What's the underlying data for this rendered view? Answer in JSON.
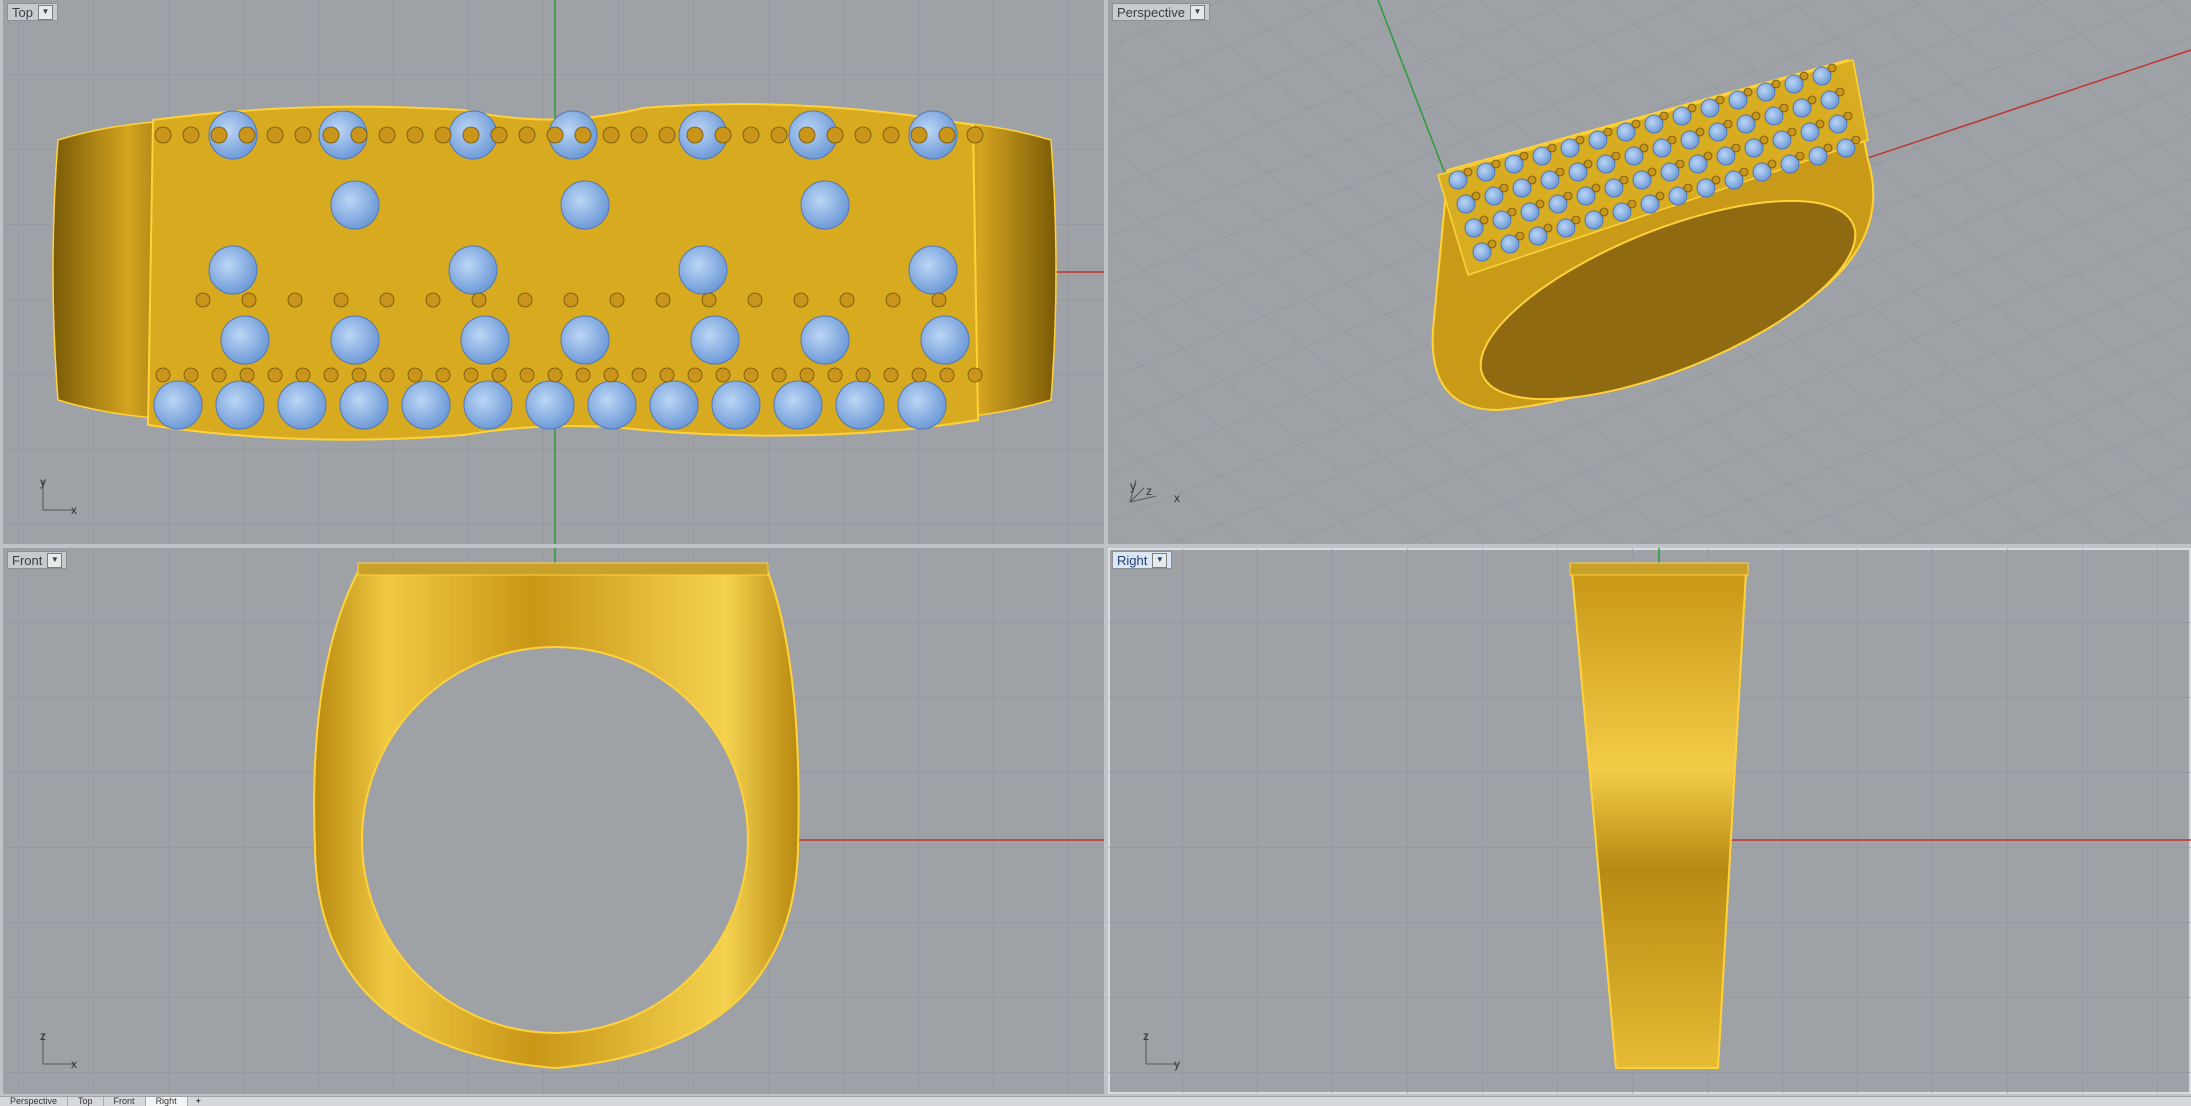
{
  "viewports": [
    {
      "id": "top",
      "title": "Top",
      "axes": [
        "y",
        "x"
      ],
      "active": false
    },
    {
      "id": "perspective",
      "title": "Perspective",
      "axes": [
        "y",
        "z",
        "x"
      ],
      "active": false
    },
    {
      "id": "front",
      "title": "Front",
      "axes": [
        "z",
        "x"
      ],
      "active": false
    },
    {
      "id": "right",
      "title": "Right",
      "axes": [
        "z",
        "y"
      ],
      "active": true
    }
  ],
  "tabs": [
    "Perspective",
    "Top",
    "Front",
    "Right",
    "+"
  ],
  "colors": {
    "viewport_bg": "#9ea2a7",
    "grid": "#8f9398",
    "x_axis": "#c0312f",
    "y_axis": "#2e9b3a",
    "gold": "#e2b521",
    "gold_dark": "#9a7410",
    "gem": "#8fb6e8",
    "selected_edge": "#ffd23a",
    "active_label": "#dde7f4"
  },
  "icons": [
    "dropdown-arrow-icon",
    "axis-triad-icon"
  ]
}
